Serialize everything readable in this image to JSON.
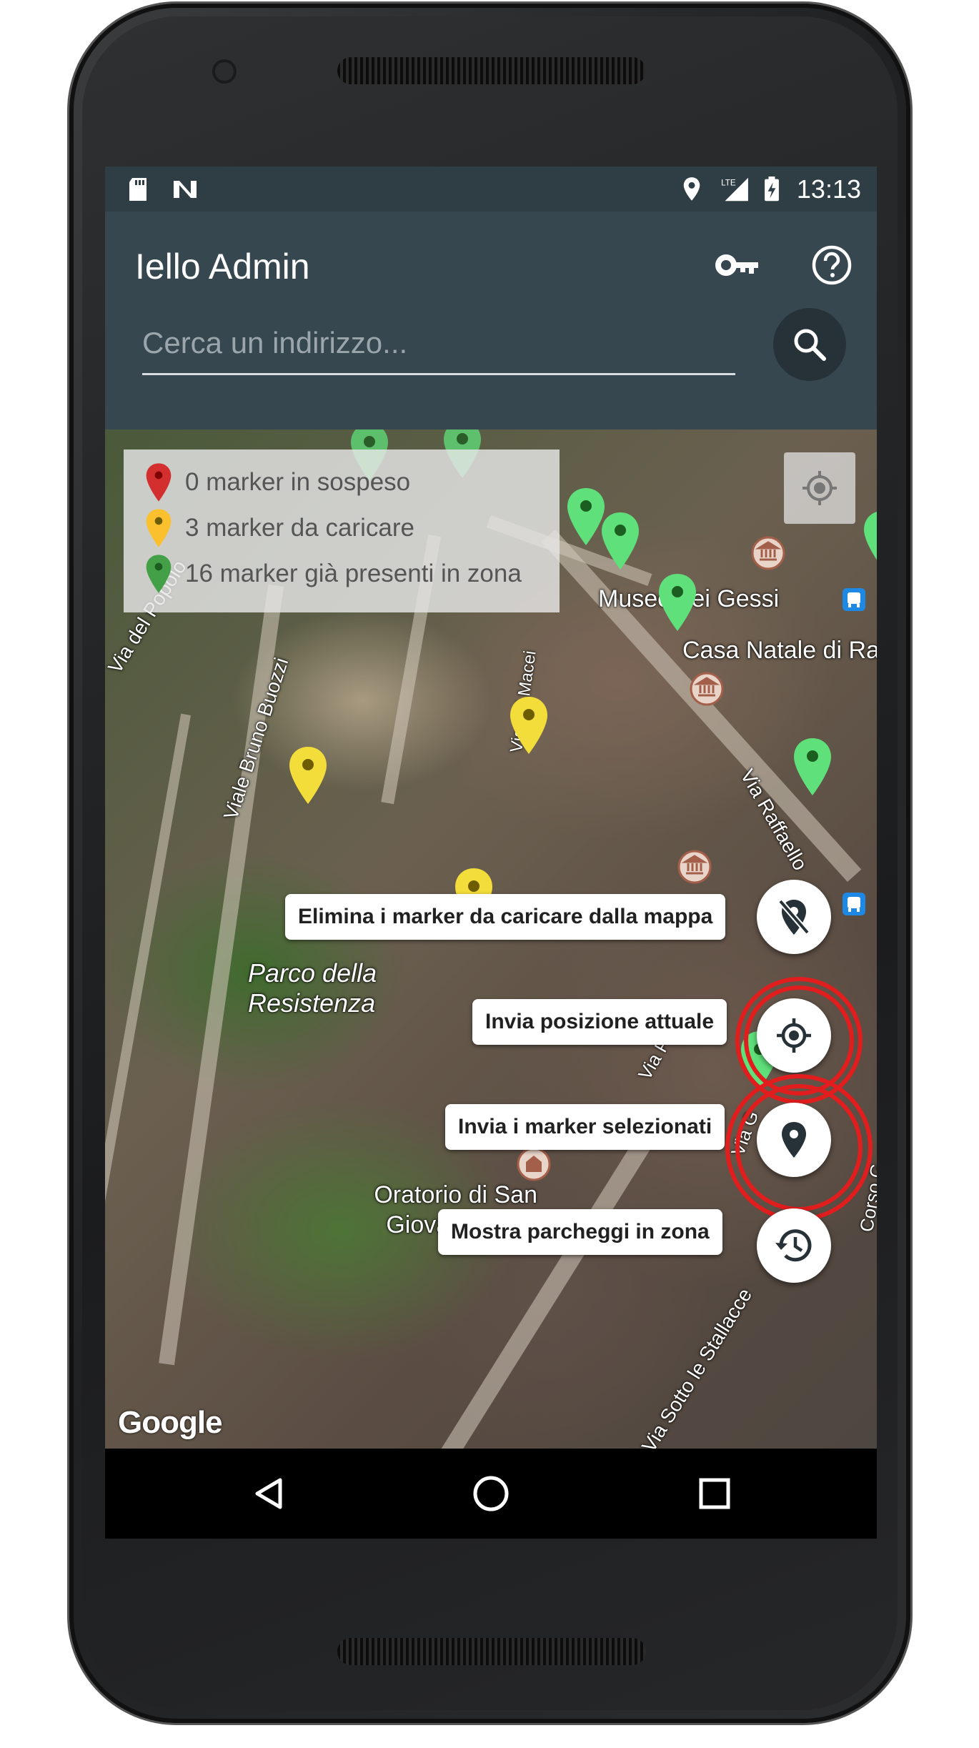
{
  "status_bar": {
    "time": "13:13",
    "icons": [
      "sd-card-icon",
      "nfc-icon",
      "location-icon",
      "lte-signal-icon",
      "battery-charging-icon"
    ],
    "network_label": "LTE"
  },
  "app_bar": {
    "title": "Iello Admin",
    "actions": [
      "key-icon",
      "help-icon"
    ]
  },
  "search": {
    "placeholder": "Cerca un indirizzo...",
    "value": ""
  },
  "legend": {
    "items": [
      {
        "label": "0 marker in sospeso",
        "color": "#d32f2f"
      },
      {
        "label": "3 marker da caricare",
        "color": "#fbc02d"
      },
      {
        "label": "16 marker già presenti in zona",
        "color": "#43a047"
      }
    ]
  },
  "map": {
    "attribution": "Google",
    "labels": {
      "via_del_popolo": "Via del Popolo",
      "viale_bruno_buozzi": "Viale Bruno Buozzi",
      "via_macei": "Via dei Macei",
      "museo": "Museo dei Gessi",
      "casa_natale": "Casa Natale di Ra",
      "via_raffaello": "Via Raffaello",
      "parco": "Parco della Resistenza",
      "oratorio": "Oratorio di San Giovanni Batti",
      "via_sotto": "Via Sotto le Stallacce",
      "corso": "Corso G",
      "via_p": "Via P",
      "via_g": "Via G"
    }
  },
  "fab_menu": {
    "items": [
      {
        "label": "Elimina i marker da caricare dalla mappa",
        "icon": "location-off-icon"
      },
      {
        "label": "Invia posizione attuale",
        "icon": "gps-fixed-icon"
      },
      {
        "label": "Invia i marker selezionati",
        "icon": "place-icon"
      },
      {
        "label": "Mostra parcheggi in zona",
        "icon": "history-icon"
      }
    ],
    "close_symbol": "×"
  },
  "colors": {
    "toolbar": "#37474f",
    "status_bar": "#2f3d44",
    "highlight_ring": "#e11d1d",
    "marker_green": "#5fe07a",
    "marker_yellow": "#f2dd3a"
  }
}
